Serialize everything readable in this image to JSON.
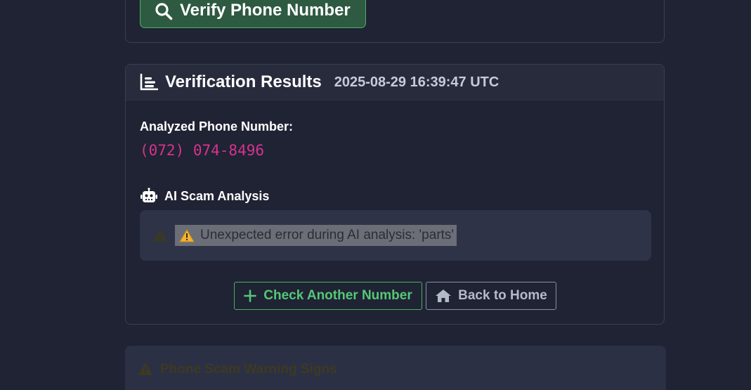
{
  "verify_button": {
    "label": "Verify Phone Number",
    "icon": "search-icon"
  },
  "results": {
    "title": "Verification Results",
    "timestamp": "2025-08-29 16:39:47 UTC",
    "analyzed_label": "Analyzed Phone Number:",
    "phone_number": "(072) 074-8496",
    "ai_section_title": "AI Scam Analysis",
    "ai_error": "Unexpected error during AI analysis: 'parts'"
  },
  "actions": {
    "check_another_label": "Check Another Number",
    "back_home_label": "Back to Home"
  },
  "warning_section": {
    "title": "Phone Scam Warning Signs"
  },
  "colors": {
    "background": "#1f2333",
    "success": "#55c777",
    "phone_accent": "#d6338f",
    "warning_muted": "#3d3a22"
  }
}
